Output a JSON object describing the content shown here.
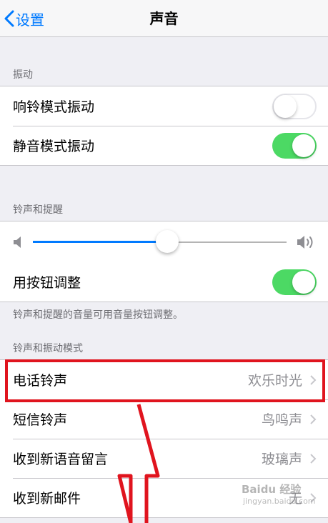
{
  "navbar": {
    "back_label": "设置",
    "title": "声音"
  },
  "vibrate": {
    "header": "振动",
    "rows": [
      {
        "label": "响铃模式振动",
        "on": false
      },
      {
        "label": "静音模式振动",
        "on": true
      }
    ]
  },
  "ringer": {
    "header": "铃声和提醒",
    "volume_level": 0.53,
    "change_with_buttons_label": "用按钮调整",
    "change_with_buttons_on": true,
    "footer": "铃声和提醒的音量可用音量按钮调整。"
  },
  "patterns": {
    "header": "铃声和振动模式",
    "rows": [
      {
        "label": "电话铃声",
        "value": "欢乐时光"
      },
      {
        "label": "短信铃声",
        "value": "鸟鸣声"
      },
      {
        "label": "收到新语音留言",
        "value": "玻璃声"
      },
      {
        "label": "收到新邮件",
        "value": "无"
      }
    ]
  },
  "colors": {
    "accent": "#007aff",
    "toggle_on": "#4cd964",
    "annotation": "#e0141e"
  },
  "watermark": {
    "text": "Baidu 经验",
    "sub": "jingyan.baidu.com"
  }
}
